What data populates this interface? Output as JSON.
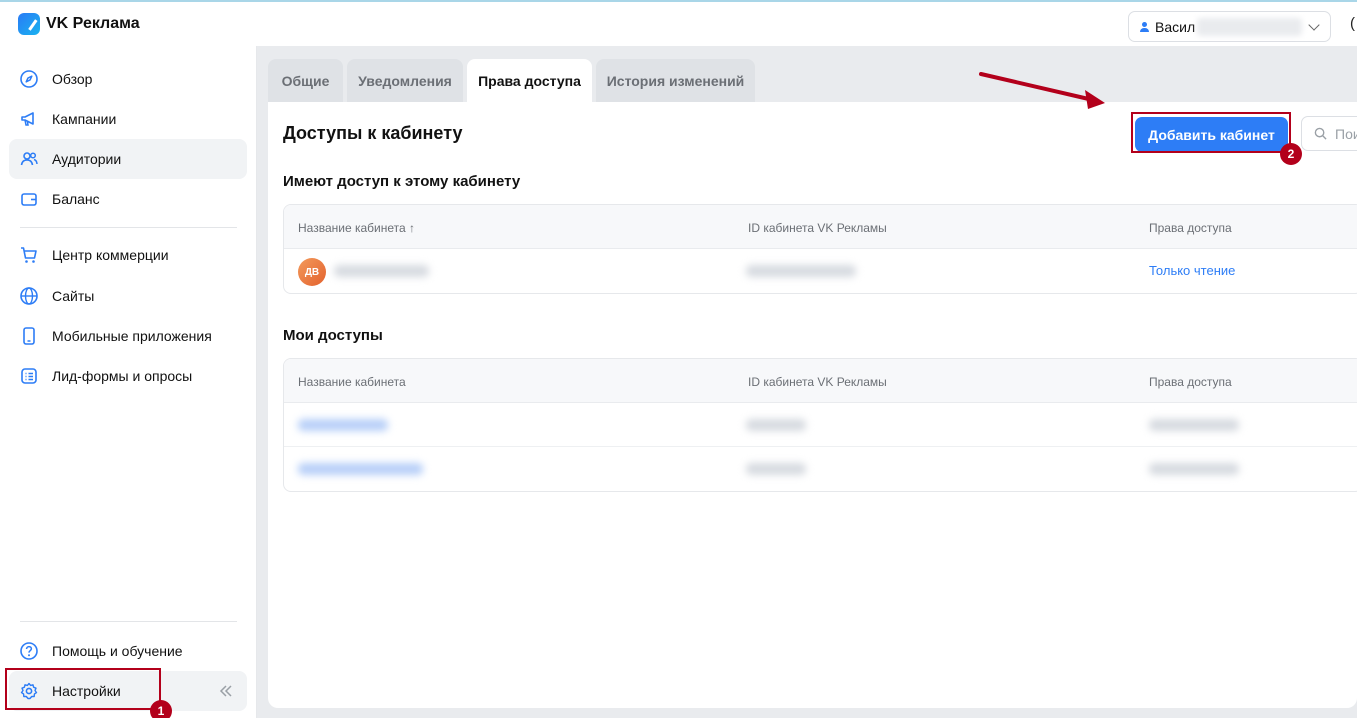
{
  "app": {
    "logo_text": "VK Реклама"
  },
  "header": {
    "account_name": "Васил",
    "edge_char": "("
  },
  "sidebar": {
    "items": [
      {
        "label": "Обзор",
        "icon": "compass-icon"
      },
      {
        "label": "Кампании",
        "icon": "megaphone-icon"
      },
      {
        "label": "Аудитории",
        "icon": "users-icon",
        "active": true
      },
      {
        "label": "Баланс",
        "icon": "wallet-icon"
      },
      {
        "label": "Центр коммерции",
        "icon": "cart-icon"
      },
      {
        "label": "Сайты",
        "icon": "globe-icon"
      },
      {
        "label": "Мобильные приложения",
        "icon": "phone-icon"
      },
      {
        "label": "Лид-формы и опросы",
        "icon": "list-icon"
      },
      {
        "label": "Помощь и обучение",
        "icon": "help-icon"
      },
      {
        "label": "Настройки",
        "icon": "gear-icon"
      }
    ]
  },
  "tabs": [
    {
      "label": "Общие"
    },
    {
      "label": "Уведомления"
    },
    {
      "label": "Права доступа",
      "active": true
    },
    {
      "label": "История изменений"
    }
  ],
  "main": {
    "title": "Доступы к кабинету",
    "add_button": "Добавить кабинет",
    "search_placeholder": "Пои",
    "section1": {
      "title": "Имеют доступ к этому кабинету",
      "columns": [
        "Название кабинета",
        "ID кабинета VK Рекламы",
        "Права доступа"
      ],
      "sort_mark": "↑",
      "rows": [
        {
          "avatar": "ДВ",
          "access": "Только чтение"
        }
      ]
    },
    "section2": {
      "title": "Мои доступы",
      "columns": [
        "Название кабинета",
        "ID кабинета VK Рекламы",
        "Права доступа"
      ]
    }
  },
  "annotations": {
    "marker1": "1",
    "marker2": "2",
    "color": "#b3001b"
  },
  "colors": {
    "accent": "#2d7df6",
    "background": "#e9ebee"
  }
}
